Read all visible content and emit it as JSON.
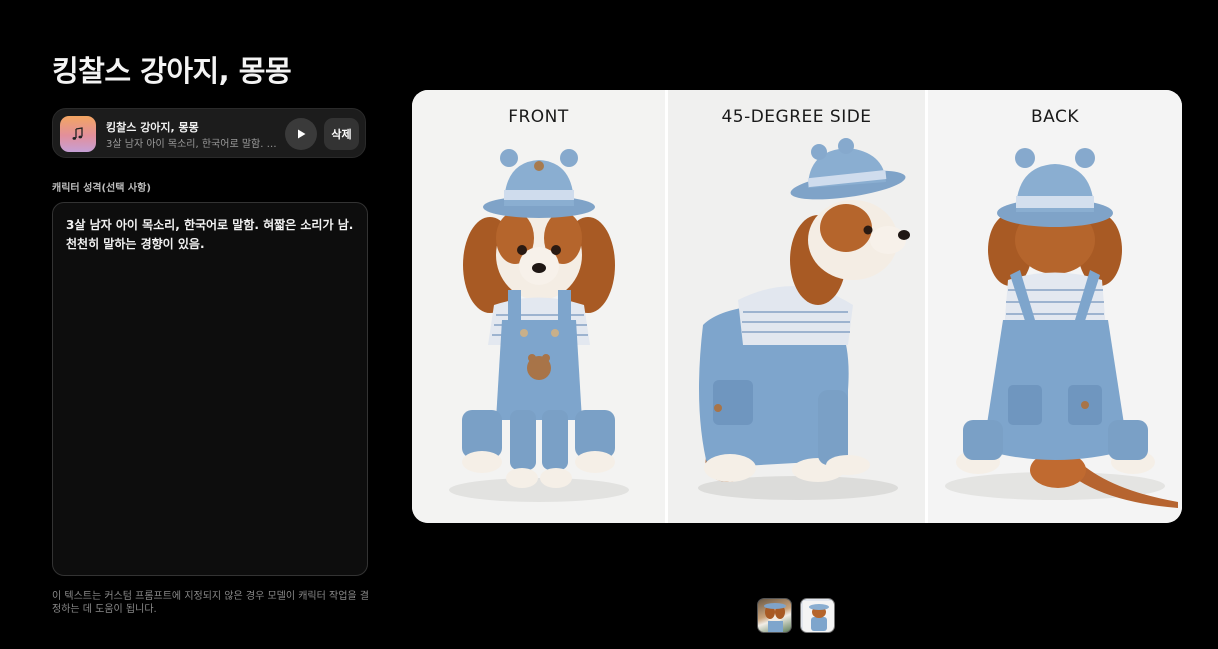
{
  "page": {
    "title": "킹찰스 강아지, 몽몽"
  },
  "voice": {
    "name": "킹찰스 강아지, 몽몽",
    "description": "3살 남자 아이 목소리, 한국어로 말함. 혀짧은 소리가 남. 천천히 말하는 경향이 있음.",
    "delete_label": "삭제",
    "play_icon": "play-icon",
    "thumb_icon": "music-note-icon"
  },
  "persona": {
    "label": "캐릭터 성격(선택 사항)",
    "value": "3살 남자 아이 목소리, 한국어로 말함. 혀짧은 소리가 남. 천천히 말하는 경향이 있음.",
    "hint": "이 텍스트는 커스텀 프롬프트에 지정되지 않은 경우 모델이 캐릭터 작업을 결정하는 데 도움이 됩니다."
  },
  "sheet": {
    "views": [
      "FRONT",
      "45-DEGREE SIDE",
      "BACK"
    ]
  },
  "gallery": {
    "count": 2,
    "selected": 1
  }
}
